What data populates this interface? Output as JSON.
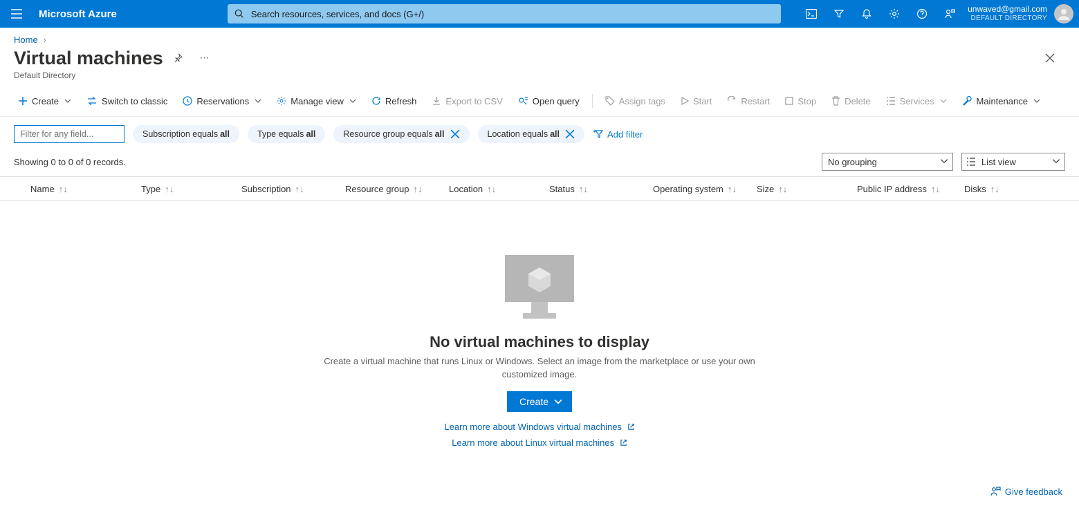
{
  "header": {
    "brand": "Microsoft Azure",
    "search_placeholder": "Search resources, services, and docs (G+/)",
    "user_email": "unwaved@gmail.com",
    "directory_label": "DEFAULT DIRECTORY"
  },
  "breadcrumb": {
    "home": "Home"
  },
  "page": {
    "title": "Virtual machines",
    "subtitle": "Default Directory"
  },
  "toolbar": {
    "create": "Create",
    "switch": "Switch to classic",
    "reservations": "Reservations",
    "manage_view": "Manage view",
    "refresh": "Refresh",
    "export_csv": "Export to CSV",
    "open_query": "Open query",
    "assign_tags": "Assign tags",
    "start": "Start",
    "restart": "Restart",
    "stop": "Stop",
    "delete": "Delete",
    "services": "Services",
    "maintenance": "Maintenance"
  },
  "filters": {
    "input_placeholder": "Filter for any field...",
    "subscription_prefix": "Subscription equals ",
    "subscription_val": "all",
    "type_prefix": "Type equals ",
    "type_val": "all",
    "rg_prefix": "Resource group equals ",
    "rg_val": "all",
    "location_prefix": "Location equals ",
    "location_val": "all",
    "add_filter": "Add filter"
  },
  "status": {
    "text": "Showing 0 to 0 of 0 records.",
    "grouping": "No grouping",
    "view_mode": "List view"
  },
  "columns": {
    "name": "Name",
    "type": "Type",
    "subscription": "Subscription",
    "resource_group": "Resource group",
    "location": "Location",
    "status": "Status",
    "os": "Operating system",
    "size": "Size",
    "public_ip": "Public IP address",
    "disks": "Disks"
  },
  "empty": {
    "heading": "No virtual machines to display",
    "body": "Create a virtual machine that runs Linux or Windows. Select an image from the marketplace or use your own customized image.",
    "create": "Create",
    "learn_windows": "Learn more about Windows virtual machines",
    "learn_linux": "Learn more about Linux virtual machines"
  },
  "feedback": {
    "label": "Give feedback"
  }
}
